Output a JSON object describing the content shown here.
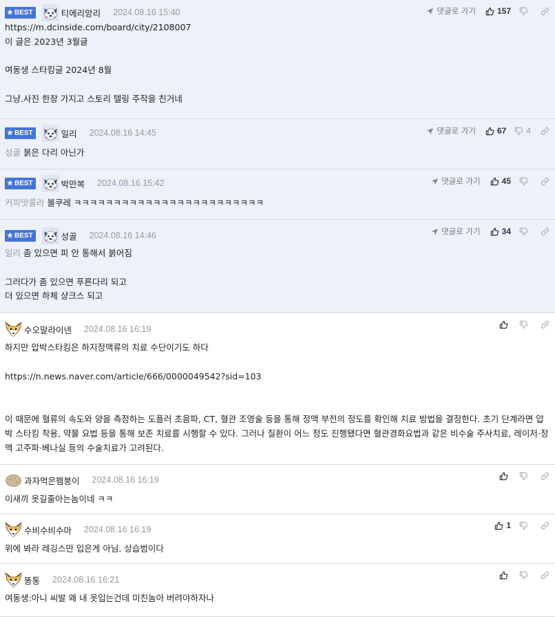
{
  "comments": [
    {
      "best": true,
      "badge_label": "BEST",
      "nickname": "티에리앙리",
      "avatar_icon": "dccon-dog-icon",
      "date": "2024.08.16 15:40",
      "reply_label": "댓글로 가기",
      "likes": "157",
      "dislikes": "",
      "lines": [
        {
          "text": "https://m.dcinside.com/board/city/2108007"
        },
        {
          "text": "이 글은 2023년 3월글"
        },
        {
          "text": ""
        },
        {
          "text": "여동생 스타킹글 2024년 8월"
        },
        {
          "text": ""
        },
        {
          "text": "그냥.사진 한장 가지고 스토리 텔링 주작을 친거네"
        }
      ]
    },
    {
      "best": true,
      "badge_label": "BEST",
      "nickname": "일리",
      "avatar_icon": "dccon-dog-icon",
      "date": "2024.08.16 14:45",
      "reply_label": "댓글로 가기",
      "likes": "67",
      "dislikes": "4",
      "lines": [
        {
          "mention": "성골",
          "text": " 붉은 다리 아닌가"
        }
      ]
    },
    {
      "best": true,
      "badge_label": "BEST",
      "nickname": "박만복",
      "avatar_icon": "dccon-dog-icon",
      "date": "2024.08.16 15:42",
      "reply_label": "댓글로 가기",
      "likes": "45",
      "dislikes": "",
      "lines": [
        {
          "mention": "커피맛콜라",
          "text": " 볼쿠레 ㅋㅋㅋㅋㅋㅋㅋㅋㅋㅋㅋㅋㅋㅋㅋㅋㅋㅋㅋㅋㅋㅋㅋㅋ"
        }
      ]
    },
    {
      "best": true,
      "badge_label": "BEST",
      "nickname": "성골",
      "avatar_icon": "dccon-dog-icon",
      "date": "2024.08.16 14:46",
      "reply_label": "댓글로 가기",
      "likes": "34",
      "dislikes": "",
      "lines": [
        {
          "mention": "일리",
          "text": " 좀 있으면 피 안 통해서 붉어짐"
        },
        {
          "text": ""
        },
        {
          "text": "그러다가 좀 있으면 푸른다리 되고"
        },
        {
          "text": "더 있으면 하체 샹크스 되고"
        }
      ]
    },
    {
      "best": false,
      "nickname": "수오말라이넨",
      "avatar_icon": "fox-face-icon",
      "date": "2024.08.16 16:19",
      "likes": "",
      "dislikes": "",
      "lines": [
        {
          "text": "하지만 압박스타킹은 하지정맥류의 치료 수단이기도 하다"
        },
        {
          "text": ""
        },
        {
          "text": "https://n.news.naver.com/article/666/0000049542?sid=103"
        },
        {
          "text": ""
        },
        {
          "text": ""
        },
        {
          "text": "이 때문에 혈류의 속도와 양을 측정하는 도플러 초음파, CT, 혈관 조영술 등을 통해 정맥 부전의 정도를 확인해 치료 방법을 결정한다. 초기 단계라면 압박 스타킹 착용, 약물 요법 등을 통해 보존 치료를 시행할 수 있다. 그러나 질환이 어느 정도 진행됐다면 혈관경화요법과 같은 비수술 주사치료, 레이저·정맥 고주파·베나실 등의 수술치료가 고려된다."
        }
      ]
    },
    {
      "best": false,
      "nickname": "과자먹은펨붕이",
      "avatar_icon": "potato-icon",
      "date": "2024.08.16 16:19",
      "likes": "",
      "dislikes": "",
      "lines": [
        {
          "text": "이새끼 옷길줄아는놈이네 ㅋㅋ"
        }
      ]
    },
    {
      "best": false,
      "nickname": "수비수비수마",
      "avatar_icon": "fox-face-icon",
      "date": "2024.08.16 16:19",
      "likes": "1",
      "dislikes": "",
      "lines": [
        {
          "text": "위에 봐라 레깅스만 입은게 아님. 상습범이다"
        }
      ]
    },
    {
      "best": false,
      "nickname": "똥통",
      "avatar_icon": "fox-face-icon",
      "date": "2024.08.16 16:21",
      "likes": "",
      "dislikes": "",
      "lines": [
        {
          "text": "여동생:아니 씨발 왜 내 옷입는건데 미친놈아 버려야하자나"
        }
      ]
    }
  ],
  "colors": {
    "best_bg": "#eef1f9",
    "badge": "#4474d6",
    "meta_text": "#999999",
    "mention": "#9a9a9a"
  }
}
